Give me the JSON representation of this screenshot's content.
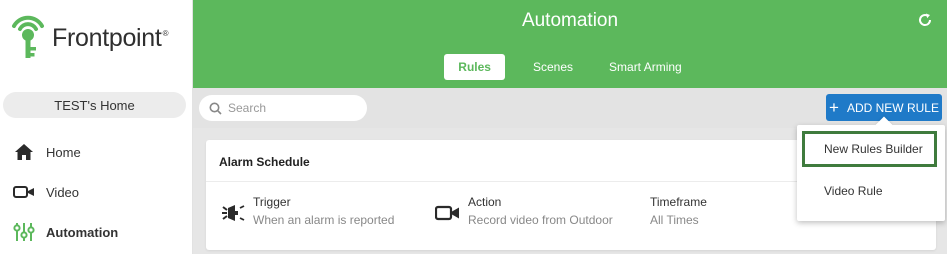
{
  "brand": {
    "name": "Frontpoint",
    "trademark": "®",
    "green": "#5cb85c",
    "blue": "#1f7ac8"
  },
  "sidebar": {
    "home_name": "TEST's Home",
    "items": [
      {
        "label": "Home",
        "icon": "house-icon",
        "active": false
      },
      {
        "label": "Video",
        "icon": "video-camera-icon",
        "active": false
      },
      {
        "label": "Automation",
        "icon": "sliders-icon",
        "active": true
      }
    ]
  },
  "header": {
    "title": "Automation",
    "refresh_icon": "refresh-icon",
    "tabs": [
      {
        "label": "Rules",
        "active": true
      },
      {
        "label": "Scenes",
        "active": false
      },
      {
        "label": "Smart Arming",
        "active": false
      }
    ]
  },
  "toolbar": {
    "search_placeholder": "Search",
    "add_button_label": "ADD NEW RULE"
  },
  "rule_card": {
    "title": "Alarm Schedule",
    "trigger": {
      "label": "Trigger",
      "value": "When an alarm is reported"
    },
    "action": {
      "label": "Action",
      "value": "Record video from Outdoor"
    },
    "timeframe": {
      "label": "Timeframe",
      "value": "All Times"
    }
  },
  "dropdown": {
    "items": [
      {
        "label": "New Rules Builder",
        "highlighted": true
      },
      {
        "label": "Video Rule",
        "highlighted": false
      }
    ]
  }
}
